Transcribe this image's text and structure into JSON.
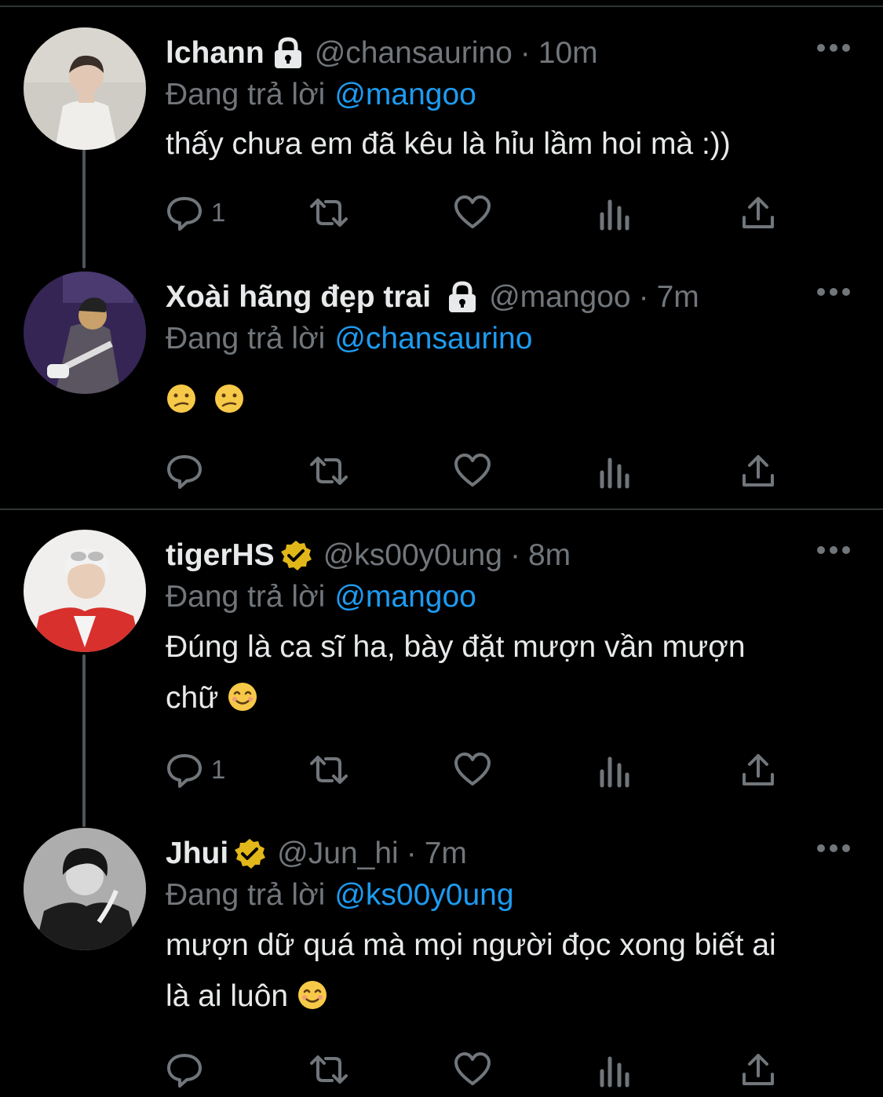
{
  "colors": {
    "background": "#000000",
    "text_primary": "#e7e9ea",
    "text_secondary": "#71767b",
    "mention": "#1d9bf0",
    "verified_badge": "#e2b719",
    "divider": "#2f3336"
  },
  "reply_prefix": "Đang trả lời",
  "tweets": [
    {
      "display_name": "lchann",
      "badge": "lock-icon",
      "handle": "@chansaurino",
      "separator": "·",
      "time": "10m",
      "reply_to": "@mangoo",
      "text": "thấy chưa em đã kêu là hỉu lầm hoi mà :))",
      "reply_count": "1"
    },
    {
      "display_name": "Xoài hãng đẹp trai",
      "badge": "lock-icon",
      "handle": "@mangoo",
      "separator": "·",
      "time": "7m",
      "reply_to": "@chansaurino",
      "text": "",
      "emojis": [
        "confused-face-emoji",
        "confused-face-emoji"
      ],
      "reply_count": ""
    },
    {
      "display_name": "tigerHS",
      "badge": "verified-icon",
      "handle": "@ks00y0ung",
      "separator": "·",
      "time": "8m",
      "reply_to": "@mangoo",
      "text_line1": "Đúng là ca sĩ ha, bày đặt mượn vần mượn",
      "text_line2": "chữ",
      "emojis": [
        "smiling-face-emoji"
      ],
      "reply_count": "1"
    },
    {
      "display_name": "Jhui",
      "badge": "verified-icon",
      "handle": "@Jun_hi",
      "separator": "·",
      "time": "7m",
      "reply_to": "@ks00y0ung",
      "text_line1": "mượn dữ quá mà mọi người đọc xong biết ai",
      "text_line2": "là ai luôn",
      "emojis": [
        "smiling-face-emoji"
      ],
      "reply_count": ""
    }
  ],
  "action_icons": [
    "reply-icon",
    "retweet-icon",
    "like-icon",
    "analytics-icon",
    "share-icon"
  ]
}
